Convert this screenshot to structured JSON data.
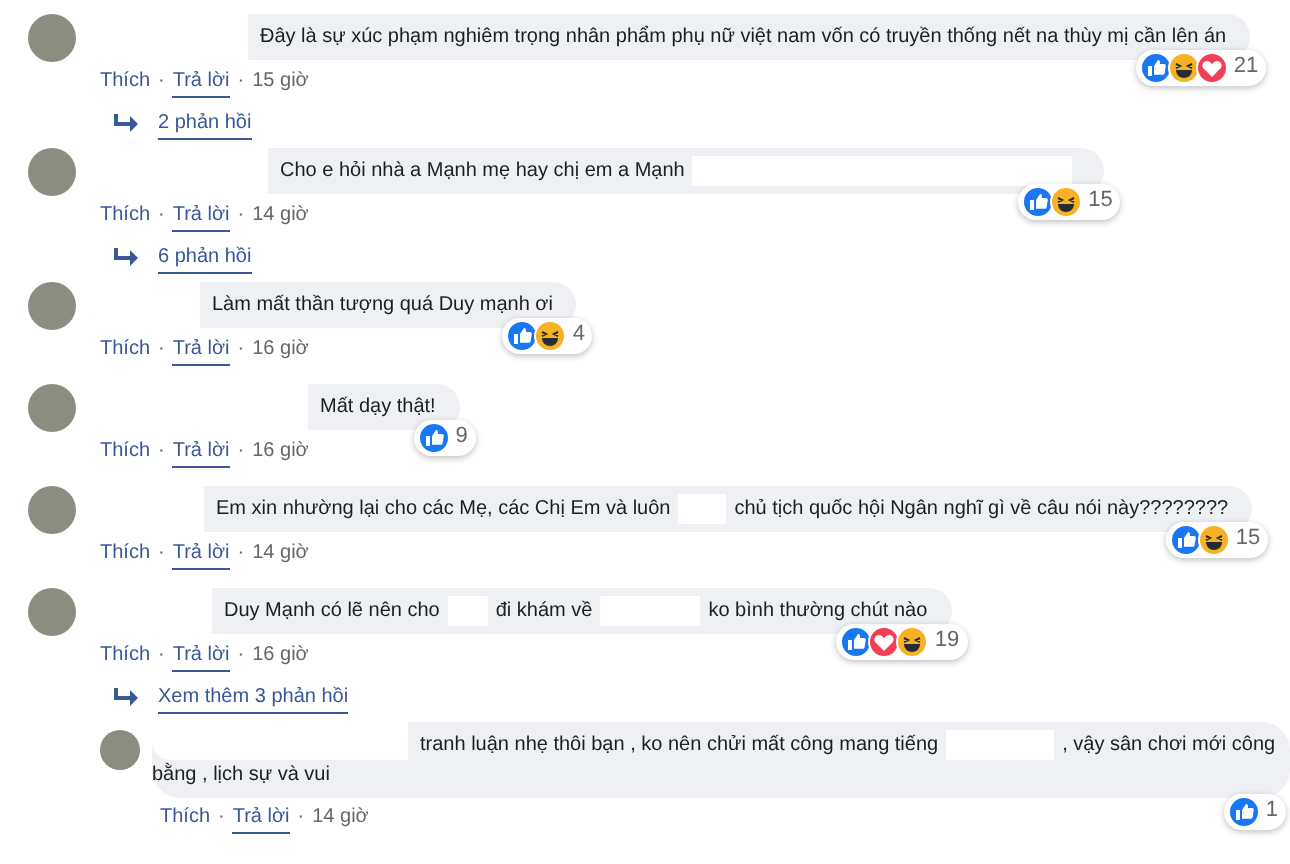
{
  "separator": "·",
  "comments": [
    {
      "kind": "comment",
      "segments": [
        {
          "kind": "redacted"
        },
        {
          "kind": "text",
          "text": "Đây là sự xúc phạm nghiêm trọng nhân phẩm phụ nữ việt nam vốn có truyền thống nết na thùy mị cần lên án"
        }
      ],
      "reactions": {
        "icons": [
          {
            "kind": "like"
          },
          {
            "kind": "haha"
          },
          {
            "kind": "love"
          }
        ],
        "count": "21"
      },
      "actions": [
        {
          "kind": "like",
          "text": "Thích"
        },
        {
          "kind": "reply",
          "text": "Trả lời"
        },
        {
          "kind": "time",
          "text": "15 giờ"
        }
      ],
      "replies_link": "2 phản hồi"
    },
    {
      "kind": "comment",
      "segments": [
        {
          "kind": "redacted"
        },
        {
          "kind": "text",
          "text": "Cho e hỏi nhà a Mạnh mẹ hay chị em a Mạnh"
        },
        {
          "kind": "redacted"
        }
      ],
      "reactions": {
        "icons": [
          {
            "kind": "like"
          },
          {
            "kind": "haha"
          }
        ],
        "count": "15"
      },
      "actions": [
        {
          "kind": "like",
          "text": "Thích"
        },
        {
          "kind": "reply",
          "text": "Trả lời"
        },
        {
          "kind": "time",
          "text": "14 giờ"
        }
      ],
      "replies_link": "6 phản hồi"
    },
    {
      "kind": "comment",
      "segments": [
        {
          "kind": "redacted"
        },
        {
          "kind": "text",
          "text": "Làm mất thần tượng quá Duy mạnh ơi"
        }
      ],
      "reactions": {
        "icons": [
          {
            "kind": "like"
          },
          {
            "kind": "haha"
          }
        ],
        "count": "4"
      },
      "actions": [
        {
          "kind": "like",
          "text": "Thích"
        },
        {
          "kind": "reply",
          "text": "Trả lời"
        },
        {
          "kind": "time",
          "text": "16 giờ"
        }
      ]
    },
    {
      "kind": "comment",
      "segments": [
        {
          "kind": "redacted"
        },
        {
          "kind": "text",
          "text": "Mất dạy thật!"
        }
      ],
      "reactions": {
        "icons": [
          {
            "kind": "like"
          }
        ],
        "count": "9"
      },
      "actions": [
        {
          "kind": "like",
          "text": "Thích"
        },
        {
          "kind": "reply",
          "text": "Trả lời"
        },
        {
          "kind": "time",
          "text": "16 giờ"
        }
      ]
    },
    {
      "kind": "comment",
      "segments": [
        {
          "kind": "redacted"
        },
        {
          "kind": "text",
          "text": "Em xin nhường lại cho các Mẹ, các Chị Em và luôn"
        },
        {
          "kind": "redacted"
        },
        {
          "kind": "text",
          "text": "chủ tịch quốc hội Ngân nghĩ gì về câu nói này????????"
        }
      ],
      "reactions": {
        "icons": [
          {
            "kind": "like"
          },
          {
            "kind": "haha"
          }
        ],
        "count": "15"
      },
      "actions": [
        {
          "kind": "like",
          "text": "Thích"
        },
        {
          "kind": "reply",
          "text": "Trả lời"
        },
        {
          "kind": "time",
          "text": "14 giờ"
        }
      ]
    },
    {
      "kind": "comment",
      "segments": [
        {
          "kind": "redacted"
        },
        {
          "kind": "text",
          "text": "Duy Mạnh có lẽ nên cho"
        },
        {
          "kind": "redacted"
        },
        {
          "kind": "text",
          "text": "đi khám về"
        },
        {
          "kind": "redacted"
        },
        {
          "kind": "text",
          "text": "ko bình thường chút nào"
        }
      ],
      "reactions": {
        "icons": [
          {
            "kind": "like"
          },
          {
            "kind": "love"
          },
          {
            "kind": "haha"
          }
        ],
        "count": "19"
      },
      "actions": [
        {
          "kind": "like",
          "text": "Thích"
        },
        {
          "kind": "reply",
          "text": "Trả lời"
        },
        {
          "kind": "time",
          "text": "16 giờ"
        }
      ],
      "replies_link": "Xem thêm 3 phản hồi"
    },
    {
      "kind": "reply",
      "segments": [
        {
          "kind": "redacted"
        },
        {
          "kind": "text",
          "text": "tranh luận nhẹ thôi bạn , ko nên chửi mất công mang tiếng"
        },
        {
          "kind": "redacted"
        },
        {
          "kind": "text",
          "text": ", vậy sân chơi mới công"
        },
        {
          "kind": "text",
          "text": "bằng , lịch sự và vui"
        }
      ],
      "reactions": {
        "icons": [
          {
            "kind": "like"
          }
        ],
        "count": "1"
      },
      "actions": [
        {
          "kind": "like",
          "text": "Thích"
        },
        {
          "kind": "reply",
          "text": "Trả lời"
        },
        {
          "kind": "time",
          "text": "14 giờ"
        }
      ]
    }
  ]
}
